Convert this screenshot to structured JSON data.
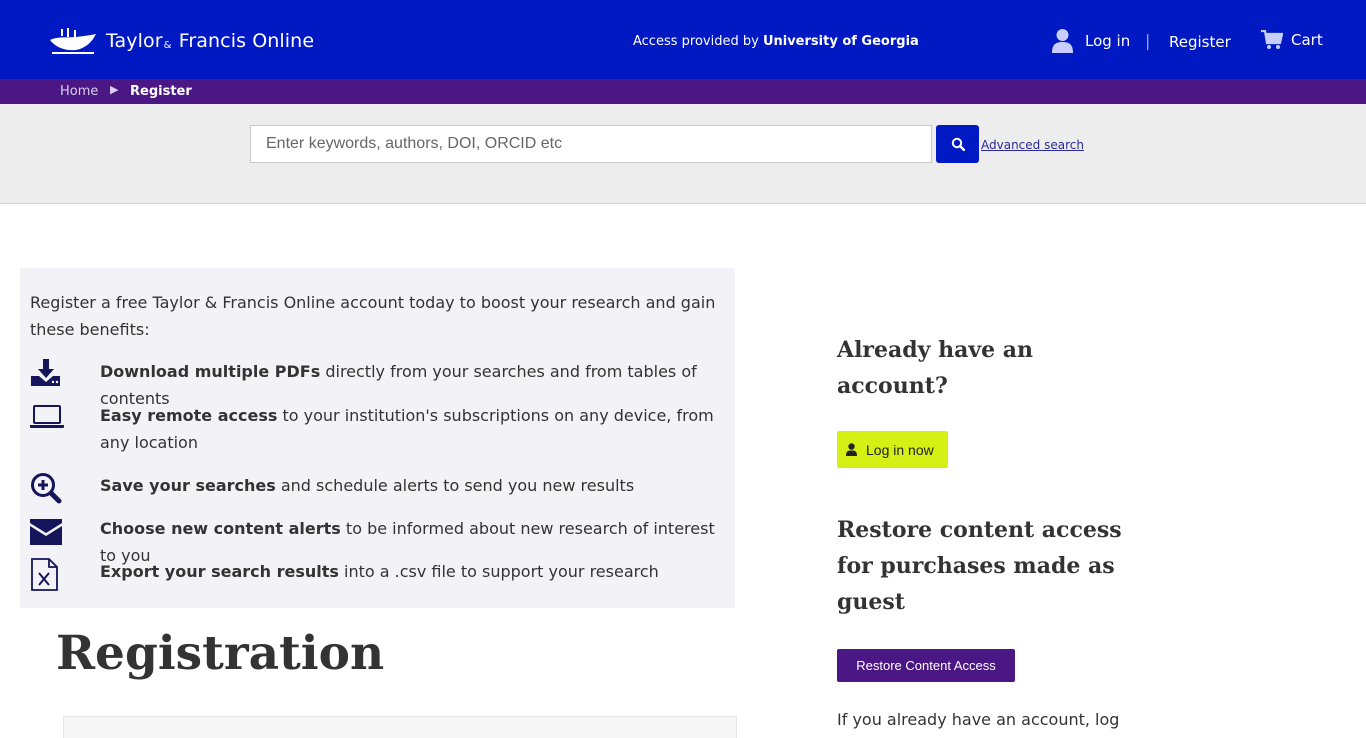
{
  "header": {
    "logo_text_a": "Taylor",
    "logo_text_amp": "&",
    "logo_text_b": "Francis Online",
    "access_prefix": "Access provided by",
    "access_institution": "University of Georgia",
    "login_label": "Log in",
    "separator": "|",
    "register_label": "Register",
    "cart_label": "Cart"
  },
  "breadcrumb": {
    "home": "Home",
    "arrow": "▶",
    "current": "Register"
  },
  "search": {
    "placeholder": "Enter keywords, authors, DOI, ORCID etc",
    "advanced_label": "Advanced search"
  },
  "benefits": {
    "intro": "Register a free Taylor & Francis Online account today to boost your research and gain these benefits:",
    "items": [
      {
        "icon": "download-icon",
        "bold": "Download multiple PDFs",
        "rest": " directly from your searches and from tables of contents"
      },
      {
        "icon": "laptop-icon",
        "bold": "Easy remote access",
        "rest": " to your institution's subscriptions on any device, from any location"
      },
      {
        "icon": "search-plus-icon",
        "bold": "Save your searches",
        "rest": " and schedule alerts to send you new results"
      },
      {
        "icon": "envelope-icon",
        "bold": "Choose new content alerts",
        "rest": " to be informed about new research of interest to you"
      },
      {
        "icon": "excel-file-icon",
        "bold": "Export your search results",
        "rest": " into a .csv file to support your research"
      }
    ]
  },
  "registration": {
    "title": "Registration"
  },
  "sidebar": {
    "already_title": "Already have an account?",
    "login_now_label": "Log in now",
    "restore_title": "Restore content access for purchases made as guest",
    "restore_button_label": "Restore Content Access",
    "restore_text": "If you already have an account, log"
  },
  "colors": {
    "header_bg": "#0019c3",
    "breadcrumb_bg": "#4b1785",
    "login_now_bg": "#d4f014",
    "restore_bg": "#4b1785"
  }
}
